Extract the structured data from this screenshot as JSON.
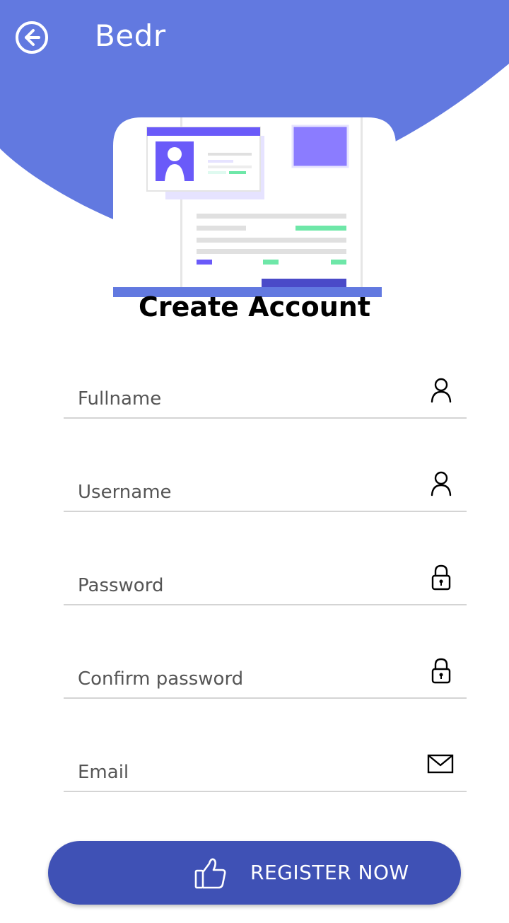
{
  "app": {
    "title": "Bedr"
  },
  "header": {
    "back_icon": "arrow-left-circle-icon",
    "bg_color": "#6279e0"
  },
  "page": {
    "title": "Create Account"
  },
  "form": {
    "fullname": {
      "placeholder": "Fullname",
      "value": "",
      "icon": "person-icon"
    },
    "username": {
      "placeholder": "Username",
      "value": "",
      "icon": "person-icon"
    },
    "password": {
      "placeholder": "Password",
      "value": "",
      "icon": "lock-icon"
    },
    "confirm_password": {
      "placeholder": "Confirm password",
      "value": "",
      "icon": "lock-icon"
    },
    "email": {
      "placeholder": "Email",
      "value": "",
      "icon": "mail-icon"
    }
  },
  "register": {
    "label": "REGISTER NOW",
    "icon": "thumbs-up-icon",
    "color": "#3f51b5"
  },
  "colors": {
    "accent": "#6a5af9",
    "accent_light": "#8b7cff",
    "green": "#6ee7a8"
  }
}
